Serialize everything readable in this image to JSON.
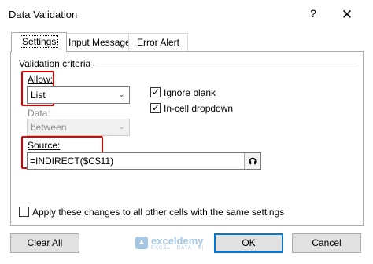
{
  "window": {
    "title": "Data Validation",
    "help_icon": "?",
    "close_icon": "✕"
  },
  "tabs": [
    {
      "label": "Settings",
      "active": true
    },
    {
      "label": "Input Message",
      "active": false
    },
    {
      "label": "Error Alert",
      "active": false
    }
  ],
  "criteria": {
    "group_label": "Validation criteria",
    "allow_label": "Allow:",
    "allow_value": "List",
    "data_label": "Data:",
    "data_value": "between",
    "source_label": "Source:",
    "source_value": "=INDIRECT($C$11)",
    "ignore_blank_label": "Ignore blank",
    "ignore_blank_checked": true,
    "incell_dropdown_label": "In-cell dropdown",
    "incell_dropdown_checked": true
  },
  "apply_all": {
    "label": "Apply these changes to all other cells with the same settings",
    "checked": false
  },
  "buttons": {
    "clear_all": "Clear All",
    "ok": "OK",
    "cancel": "Cancel"
  },
  "watermark": {
    "name": "exceldemy",
    "tagline": "EXCEL · DATA · BI"
  },
  "colors": {
    "highlight": "#e00000",
    "default_button_border": "#0078d7"
  }
}
